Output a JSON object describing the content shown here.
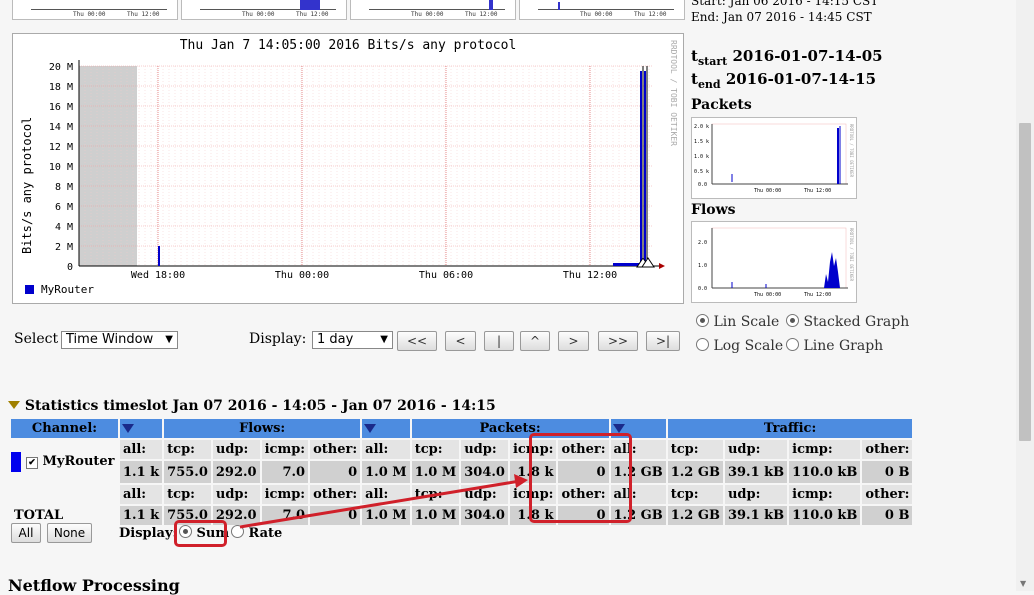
{
  "top_right": {
    "start_label": "Start:",
    "start_value": "Jan 06 2016 - 14:15 CST",
    "end_label": "End:",
    "end_value": "Jan 07 2016 - 14:45 CST"
  },
  "thumbnails": [
    {
      "labels": [
        "Thu 00:00",
        "Thu 12:00"
      ]
    },
    {
      "labels": [
        "Thu 00:00",
        "Thu 12:00"
      ]
    },
    {
      "labels": [
        "Thu 00:00",
        "Thu 12:00"
      ]
    },
    {
      "labels": [
        "Thu 00:00",
        "Thu 12:00"
      ]
    }
  ],
  "tslot": {
    "tstart_label": "t",
    "tstart_sub": "start",
    "tstart_value": "2016-01-07-14-05",
    "tend_label": "t",
    "tend_sub": "end",
    "tend_value": "2016-01-07-14-15"
  },
  "side_graphs": {
    "packets_title": "Packets",
    "flows_title": "Flows",
    "packets_y": [
      "2.0 k",
      "1.5 k",
      "1.0 k",
      "0.5 k",
      "0.0"
    ],
    "flows_y": [
      "2.0",
      "1.0",
      "0.0"
    ],
    "x": [
      "Thu 00:00",
      "Thu 12:00"
    ],
    "vert_label": "RRDTOOL / TOBI OETIKER"
  },
  "chart_data": {
    "type": "area",
    "title": "Thu Jan  7 14:05:00 2016 Bits/s any protocol",
    "ylabel": "Bits/s any protocol",
    "ytick_labels": [
      "20 M",
      "18 M",
      "16 M",
      "14 M",
      "12 M",
      "10 M",
      "8 M",
      "6 M",
      "4 M",
      "2 M",
      "0"
    ],
    "ylim": [
      0,
      20000000
    ],
    "x_tick_labels": [
      "Wed 18:00",
      "Thu 00:00",
      "Thu 06:00",
      "Thu 12:00"
    ],
    "grid": true,
    "vertical_label": "RRDTOOL / TOBI OETIKER",
    "legend_position": "bottom-left",
    "series": [
      {
        "name": "MyRouter",
        "color": "#0000cc",
        "points": [
          {
            "x": "Wed 17:15",
            "y": 2000000
          },
          {
            "x": "Thu 14:00",
            "y": 19500000
          },
          {
            "x": "Thu 14:05",
            "y": 19500000
          }
        ]
      }
    ]
  },
  "controls": {
    "select_label": "Select",
    "select_value": "Time Window",
    "display_label": "Display:",
    "display_value": "1 day",
    "buttons": [
      "<<",
      "<",
      "|",
      "^",
      ">",
      ">>",
      ">|"
    ]
  },
  "scale_options": {
    "lin": "Lin Scale",
    "log": "Log Scale",
    "stacked": "Stacked Graph",
    "line": "Line Graph"
  },
  "stats": {
    "title": "Statistics timeslot Jan 07 2016 - 14:05 - Jan 07 2016 - 14:15",
    "headers": {
      "channel": "Channel:",
      "flows": "Flows:",
      "packets": "Packets:",
      "traffic": "Traffic:"
    },
    "sublabels": [
      "all:",
      "tcp:",
      "udp:",
      "icmp:",
      "other:"
    ],
    "rows": [
      {
        "name": "MyRouter",
        "flows": [
          "1.1 k",
          "755.0",
          "292.0",
          "7.0",
          "0"
        ],
        "packets": [
          "1.0 M",
          "1.0 M",
          "304.0",
          "1.8 k",
          "0"
        ],
        "traffic": [
          "1.2 GB",
          "1.2 GB",
          "39.1 kB",
          "110.0 kB",
          "0 B"
        ]
      },
      {
        "name": "TOTAL",
        "flows": [
          "1.1 k",
          "755.0",
          "292.0",
          "7.0",
          "0"
        ],
        "packets": [
          "1.0 M",
          "1.0 M",
          "304.0",
          "1.8 k",
          "0"
        ],
        "traffic": [
          "1.2 GB",
          "1.2 GB",
          "39.1 kB",
          "110.0 kB",
          "0 B"
        ]
      }
    ],
    "all_button": "All",
    "none_button": "None",
    "display_label": "Display:",
    "sum_label": "Sum",
    "rate_label": "Rate"
  },
  "footer_heading": "Netflow Processing",
  "colors": {
    "header_blue": "#4d8ce0",
    "annotation_red": "#d0202a",
    "series_blue": "#0000cc"
  }
}
